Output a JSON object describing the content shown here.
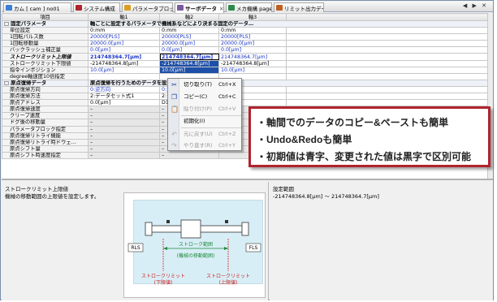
{
  "tabs": [
    {
      "label": "カム [ cam ] no01",
      "color": "#3b7fd6",
      "active": false
    },
    {
      "label": "システム構成",
      "color": "#b0242d",
      "active": false
    },
    {
      "label": "パラメータブロック",
      "color": "#d8a020",
      "active": false
    },
    {
      "label": "サーボデータ",
      "color": "#7a5aa0",
      "active": true,
      "close": "✕"
    },
    {
      "label": "メカ機構 page01",
      "color": "#2e8a4a",
      "active": false
    },
    {
      "label": "リミット出力データ",
      "color": "#c06020",
      "active": false
    }
  ],
  "tab_nav": "◀ ▶ ✕",
  "grid": {
    "headers": [
      "項目",
      "軸1",
      "軸2",
      "軸3"
    ],
    "rows": [
      {
        "type": "group",
        "cells": [
          "□ 固定パラメータ",
          "軸ごとに設定するパラメータで機械系などにより決まる固定のデータ…"
        ]
      },
      {
        "cells": [
          "単位設定",
          "0:mm",
          "0:mm",
          "0:mm"
        ],
        "color": "black"
      },
      {
        "cells": [
          "1回転パルス数",
          "20000[PLS]",
          "20000[PLS]",
          "20000[PLS]"
        ],
        "color": "blue"
      },
      {
        "cells": [
          "1回転移動量",
          "20000.0[μm]",
          "20000.0[μm]",
          "20000.0[μm]"
        ],
        "color": "blue"
      },
      {
        "cells": [
          "バックラッシュ補正量",
          "0.0[μm]",
          "0.0[μm]",
          "0.0[μm]"
        ],
        "color": "blue"
      },
      {
        "cells": [
          "ストロークリミット上限値",
          "214748364.7[μm]",
          "214748364.7[μm]",
          "214748364.7[μm]"
        ],
        "color": "blue",
        "special": "upper"
      },
      {
        "cells": [
          "ストロークリミット下限値",
          "-214748364.8[μm]",
          "-214748364.8[μm]",
          "-214748364.8[μm]"
        ],
        "color": "black",
        "special": "lower"
      },
      {
        "cells": [
          "指令インポジション",
          "10.0[μm]",
          "10.0[μm]",
          "10.0[μm]"
        ],
        "color": "blue",
        "special": "inpos"
      },
      {
        "cells": [
          "degree軸速度10倍指定",
          "",
          "",
          ""
        ],
        "color": "black"
      },
      {
        "type": "group",
        "cells": [
          "□ 原点復帰データ",
          "原点復帰を行うためのデータを設定…"
        ]
      },
      {
        "cells": [
          "原点復帰方向",
          "0:逆方向",
          "0:逆方向",
          ""
        ],
        "color": "blue"
      },
      {
        "cells": [
          "原点復帰方法",
          "2:データセット式1",
          "2:データセ…",
          ""
        ],
        "color": "black"
      },
      {
        "cells": [
          "原点アドレス",
          "0.0[μm]",
          "D1612(D)…",
          ""
        ],
        "color": "black"
      },
      {
        "cells": [
          "原点復帰速度",
          "–",
          "–",
          ""
        ],
        "color": "dis"
      },
      {
        "cells": [
          "クリープ速度",
          "–",
          "–",
          ""
        ],
        "color": "dis"
      },
      {
        "cells": [
          "ドグ後の移動量",
          "–",
          "–",
          ""
        ],
        "color": "dis"
      },
      {
        "cells": [
          "パラメータブロック指定",
          "–",
          "–",
          ""
        ],
        "color": "dis"
      },
      {
        "cells": [
          "原点復帰リトライ機能",
          "–",
          "–",
          ""
        ],
        "color": "dis"
      },
      {
        "cells": [
          "原点復帰リトライ時ドウェ…",
          "–",
          "–",
          ""
        ],
        "color": "dis"
      },
      {
        "cells": [
          "原点シフト量",
          "–",
          "–",
          ""
        ],
        "color": "dis"
      },
      {
        "cells": [
          "原点シフト時速度指定",
          "–",
          "–",
          ""
        ],
        "color": "dis"
      }
    ]
  },
  "context_menu": {
    "items": [
      {
        "label": "切り取り(T)",
        "shortcut": "Ctrl+X",
        "icon": "scissors-icon",
        "glyph": "✂",
        "disabled": false
      },
      {
        "label": "コピー(C)",
        "shortcut": "Ctrl+C",
        "icon": "copy-icon",
        "glyph": "❐",
        "disabled": false
      },
      {
        "label": "貼り付け(P)",
        "shortcut": "Ctrl+V",
        "icon": "paste-icon",
        "glyph": "📋",
        "disabled": true
      },
      {
        "label": "初期化(I)",
        "shortcut": "",
        "icon": "",
        "glyph": "",
        "disabled": false
      },
      {
        "label": "元に戻す(U)",
        "shortcut": "Ctrl+Z",
        "icon": "undo-icon",
        "glyph": "↶",
        "disabled": true
      },
      {
        "label": "やり直す(R)",
        "shortcut": "Ctrl+Y",
        "icon": "redo-icon",
        "glyph": "↷",
        "disabled": true
      }
    ]
  },
  "callout": {
    "lines": [
      "・軸間でのデータのコピー&ペーストも簡単",
      "・Undo&Redoも簡単",
      "・初期値は青字、変更された値は黒字で区別可能"
    ],
    "border_color": "#b0242d"
  },
  "help": {
    "title": "ストロークリミット上限値",
    "description": "機械の移動範囲の上限値を設定します。",
    "diagram": {
      "left_label": "FLS",
      "right_label": "RLS",
      "range_label": "ストローク範囲",
      "range_sub": "(機械の移動範囲)",
      "lower_label": "ストロークリミット",
      "lower_sub": "(下限値)",
      "upper_label": "ストロークリミット",
      "upper_sub": "(上限値)"
    }
  },
  "setting_range": {
    "title": "設定範囲",
    "value": "-214748364.8[μm] ～ 214748364.7[μm]"
  }
}
